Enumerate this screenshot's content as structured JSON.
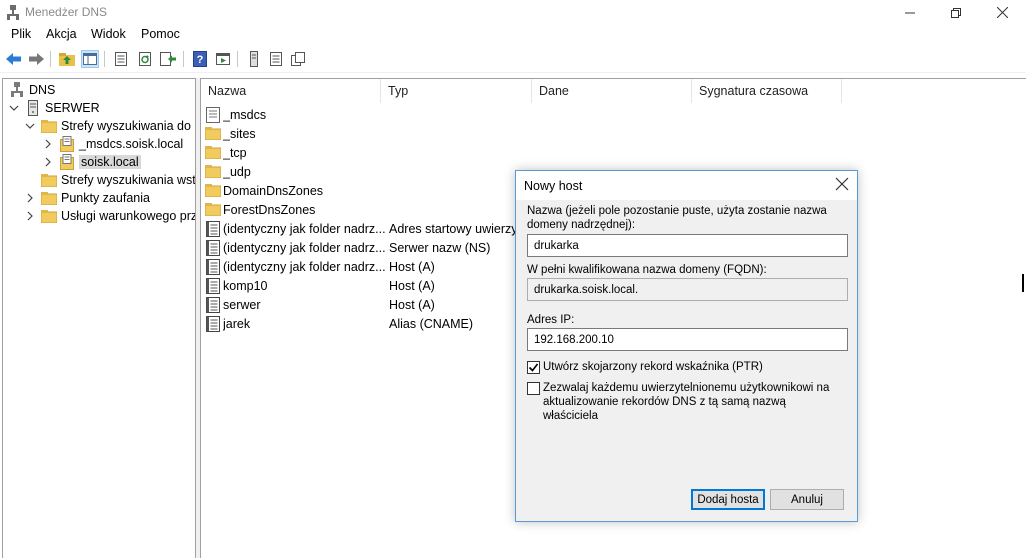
{
  "window": {
    "title": "Menedżer DNS"
  },
  "menu": [
    "Plik",
    "Akcja",
    "Widok",
    "Pomoc"
  ],
  "toolbar": {
    "icons": [
      "back-arrow-icon",
      "forward-arrow-icon",
      "up-folder-icon",
      "show-hide-tree-icon",
      "properties-icon",
      "refresh-icon",
      "export-list-icon",
      "help-icon",
      "run-icon",
      "server-icon",
      "document-icon",
      "copy-icon"
    ]
  },
  "tree": {
    "root": "DNS",
    "server": "SERWER",
    "forward_zones": "Strefy wyszukiwania do p",
    "zone_msdcs": "_msdcs.soisk.local",
    "zone_soisk": "soisk.local",
    "reverse_zones": "Strefy wyszukiwania wste",
    "trust_points": "Punkty zaufania",
    "conditional": "Usługi warunkowego prz"
  },
  "list": {
    "columns": [
      "Nazwa",
      "Typ",
      "Dane",
      "Sygnatura czasowa"
    ],
    "rows": [
      {
        "name": "_msdcs",
        "type": "",
        "icon": "zone"
      },
      {
        "name": "_sites",
        "type": "",
        "icon": "folder"
      },
      {
        "name": "_tcp",
        "type": "",
        "icon": "folder"
      },
      {
        "name": "_udp",
        "type": "",
        "icon": "folder"
      },
      {
        "name": "DomainDnsZones",
        "type": "",
        "icon": "folder"
      },
      {
        "name": "ForestDnsZones",
        "type": "",
        "icon": "folder"
      },
      {
        "name": "(identyczny jak folder nadrz...",
        "type": "Adres startowy uwierzyt...",
        "icon": "record"
      },
      {
        "name": "(identyczny jak folder nadrz...",
        "type": "Serwer nazw (NS)",
        "icon": "record"
      },
      {
        "name": "(identyczny jak folder nadrz...",
        "type": "Host (A)",
        "icon": "record"
      },
      {
        "name": "komp10",
        "type": "Host (A)",
        "icon": "record"
      },
      {
        "name": "serwer",
        "type": "Host (A)",
        "icon": "record"
      },
      {
        "name": "jarek",
        "type": "Alias (CNAME)",
        "icon": "record"
      }
    ]
  },
  "dialog": {
    "title": "Nowy host",
    "name_label": "Nazwa (jeżeli pole pozostanie puste, użyta zostanie nazwa domeny nadrzędnej):",
    "name_value": "drukarka",
    "fqdn_label": "W pełni kwalifikowana nazwa domeny (FQDN):",
    "fqdn_value": "drukarka.soisk.local.",
    "ip_label": "Adres IP:",
    "ip_value": "192.168.200.10",
    "ptr_label": "Utwórz skojarzony rekord wskaźnika (PTR)",
    "ptr_checked": true,
    "allow_label": "Zezwalaj każdemu uwierzytelnionemu użytkownikowi na aktualizowanie rekordów DNS z tą samą nazwą właściciela",
    "allow_checked": false,
    "add_button": "Dodaj hosta",
    "cancel_button": "Anuluj"
  }
}
